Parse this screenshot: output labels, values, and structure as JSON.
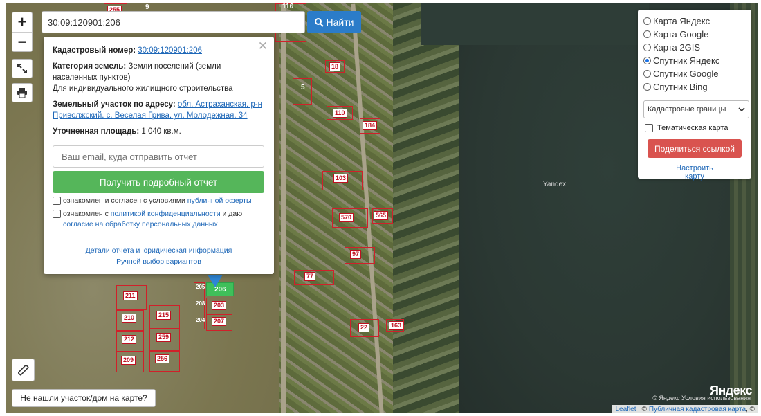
{
  "search": {
    "value": "30:09:120901:206",
    "button_label": "Найти"
  },
  "zoom": {
    "in": "+",
    "out": "−"
  },
  "popup": {
    "cadastral_label": "Кадастровый номер:",
    "cadastral_value": "30:09:120901:206",
    "category_label": "Категория земель:",
    "category_value": "Земли поселений (земли населенных пунктов)",
    "usage": "Для индивидуального жилищного строительства",
    "address_label": "Земельный участок по адресу:",
    "address_value": "обл. Астраханская, р-н Приволжский, с. Веселая Грива, ул. Молодежная, 34",
    "area_label": "Уточненная площадь:",
    "area_value": "1 040 кв.м.",
    "email_placeholder": "Ваш email, куда отправить отчет",
    "get_report": "Получить подробный отчет",
    "consent1_text": "ознакомлен и согласен с условиями ",
    "consent1_link": "публичной оферты",
    "consent2_text_a": "ознакомлен с ",
    "consent2_link_a": "политикой конфиденциальности",
    "consent2_text_b": " и даю ",
    "consent2_link_b": "согласие на обработку персональных данных",
    "details_link": "Детали отчета и юридическая информация",
    "manual_link": "Ручной выбор вариантов"
  },
  "layers": {
    "options": [
      {
        "label": "Карта Яндекс",
        "selected": false
      },
      {
        "label": "Карта Google",
        "selected": false
      },
      {
        "label": "Карта 2GIS",
        "selected": false
      },
      {
        "label": "Спутник Яндекс",
        "selected": true
      },
      {
        "label": "Спутник Google",
        "selected": false
      },
      {
        "label": "Спутник Bing",
        "selected": false
      }
    ],
    "overlay_select": "Кадастровые границы",
    "thematic_label": "Тематическая карта",
    "share_button": "Поделиться ссылкой",
    "setup_link": "Настроить карту"
  },
  "map": {
    "watermark": "Yandex",
    "logo": "Яндекс",
    "copyright": "© Яндекс  Условия использования",
    "attribution_leaflet": "Leaflet",
    "attribution_sep": " | © ",
    "attribution_source": "Публичная кадастровая карта",
    "attribution_end": ", ©",
    "parcels": [
      "255",
      "9",
      "116",
      "18",
      "5",
      "110",
      "184",
      "103",
      "570",
      "565",
      "97",
      "77",
      "211",
      "210",
      "215",
      "212",
      "259",
      "209",
      "256",
      "206",
      "203",
      "207",
      "205",
      "208",
      "204",
      "22",
      "163"
    ]
  },
  "not_found_button": "Не нашли участок/дом на карте?",
  "colors": {
    "accent_blue": "#2b7cc9",
    "green": "#55b65a",
    "red": "#d9534f",
    "parcel": "#d0202a"
  }
}
